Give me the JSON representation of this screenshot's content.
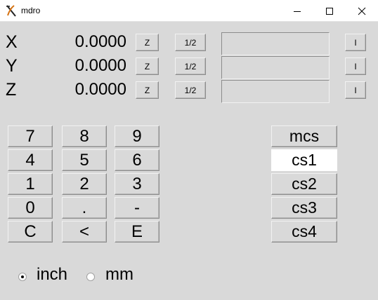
{
  "window": {
    "title": "mdro"
  },
  "axes": [
    {
      "label": "X",
      "value": "0.0000",
      "zero_label": "Z",
      "half_label": "1/2",
      "entry": "",
      "info_label": "I"
    },
    {
      "label": "Y",
      "value": "0.0000",
      "zero_label": "Z",
      "half_label": "1/2",
      "entry": "",
      "info_label": "I"
    },
    {
      "label": "Z",
      "value": "0.0000",
      "zero_label": "Z",
      "half_label": "1/2",
      "entry": "",
      "info_label": "I"
    }
  ],
  "keypad": {
    "keys": [
      "7",
      "8",
      "9",
      "4",
      "5",
      "6",
      "1",
      "2",
      "3",
      "0",
      ".",
      "-",
      "C",
      "<",
      "E"
    ]
  },
  "coord_systems": {
    "items": [
      "mcs",
      "cs1",
      "cs2",
      "cs3",
      "cs4"
    ],
    "selected": "cs1"
  },
  "units": {
    "options": [
      "inch",
      "mm"
    ],
    "selected": "inch"
  },
  "icons": {
    "app": "tk-feather-icon",
    "minimize": "minimize-icon",
    "maximize": "maximize-icon",
    "close": "close-icon"
  }
}
